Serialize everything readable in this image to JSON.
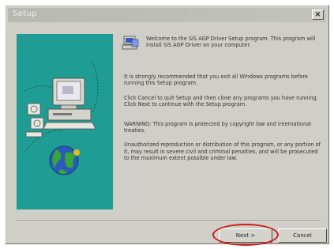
{
  "window": {
    "title": "Setup",
    "close_glyph": "×"
  },
  "content": {
    "welcome": "Welcome to the SiS AGP Driver Setup program. This program will install SiS AGP Driver on your computer.",
    "p1": "It is strongly recommended that you exit all Windows programs before running this Setup program.",
    "p2": "Click Cancel to quit Setup and then close any programs you have running. Click Next to continue with the Setup program.",
    "p3": "WARNING: This program is protected by copyright law and international treaties.",
    "p4": "Unauthorized reproduction or distribution of this program, or any portion of it, may result in severe civil and criminal penalties, and will be prosecuted to the maximum extent possible under law."
  },
  "buttons": {
    "next": "Next >",
    "cancel": "Cancel"
  },
  "colors": {
    "panel": "#1f9c93",
    "highlight": "#d21a1a"
  },
  "icons": {
    "setup": "setup-computer-icon",
    "panel": [
      "computer-icon",
      "disks-icon",
      "globe-icon"
    ]
  }
}
